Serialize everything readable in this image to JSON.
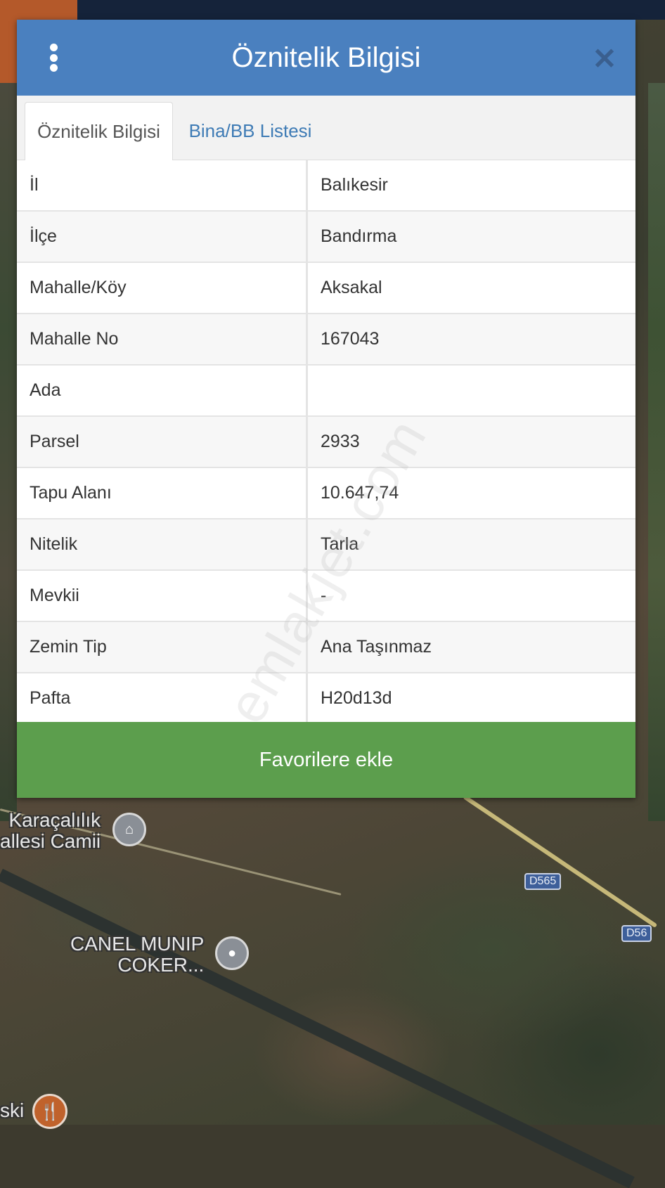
{
  "modal": {
    "title": "Öznitelik Bilgisi",
    "menu_icon": "more-vertical-icon",
    "close_icon": "close-icon"
  },
  "tabs": [
    {
      "label": "Öznitelik Bilgisi",
      "active": true
    },
    {
      "label": "Bina/BB Listesi",
      "active": false
    }
  ],
  "rows": [
    {
      "label": "İl",
      "value": "Balıkesir"
    },
    {
      "label": "İlçe",
      "value": "Bandırma"
    },
    {
      "label": "Mahalle/Köy",
      "value": "Aksakal"
    },
    {
      "label": "Mahalle No",
      "value": "167043"
    },
    {
      "label": "Ada",
      "value": ""
    },
    {
      "label": "Parsel",
      "value": "2933"
    },
    {
      "label": "Tapu Alanı",
      "value": "10.647,74"
    },
    {
      "label": "Nitelik",
      "value": "Tarla"
    },
    {
      "label": "Mevkii",
      "value": "-"
    },
    {
      "label": "Zemin Tip",
      "value": "Ana Taşınmaz"
    },
    {
      "label": "Pafta",
      "value": "H20d13d"
    }
  ],
  "favorite_button": "Favorilere ekle",
  "watermark": "emlakjet.com",
  "map": {
    "labels": {
      "mosque": "Karaçalılık\nallesi Camii",
      "place": "CANEL MUNIP\nCOKER...",
      "bottom": "ski"
    },
    "road_badges": [
      "D565",
      "D56"
    ]
  },
  "colors": {
    "header": "#4a80bf",
    "button": "#5c9e4d",
    "tab_link": "#3e7bb5"
  }
}
